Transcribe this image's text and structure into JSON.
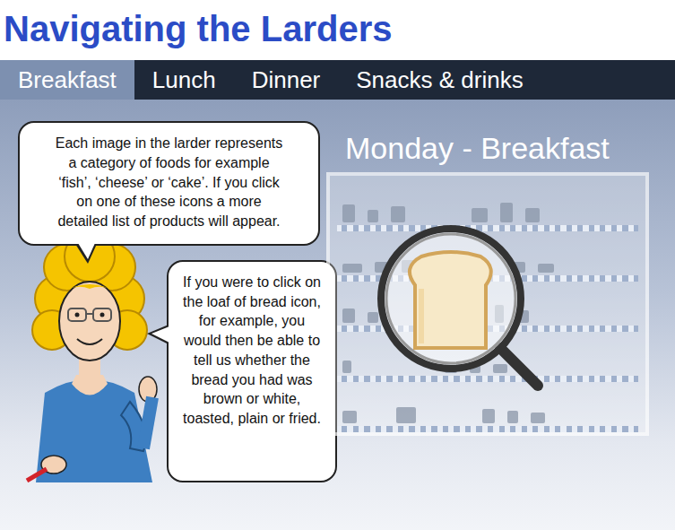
{
  "title": "Navigating the Larders",
  "tabs": [
    {
      "label": "Breakfast",
      "selected": true
    },
    {
      "label": "Lunch",
      "selected": false
    },
    {
      "label": "Dinner",
      "selected": false
    },
    {
      "label": "Snacks & drinks",
      "selected": false
    }
  ],
  "larder": {
    "heading": "Monday - Breakfast"
  },
  "bubbles": [
    {
      "text": "Each image in the larder represents a category of foods for example ‘fish’, ‘cheese’ or ‘cake’. If you click on one of these icons a more detailed list of products will appear."
    },
    {
      "text": "If you were to click on the loaf of bread icon, for example, you would then be able to tell us whether the bread you had was brown or white, toasted, plain or fried."
    }
  ]
}
